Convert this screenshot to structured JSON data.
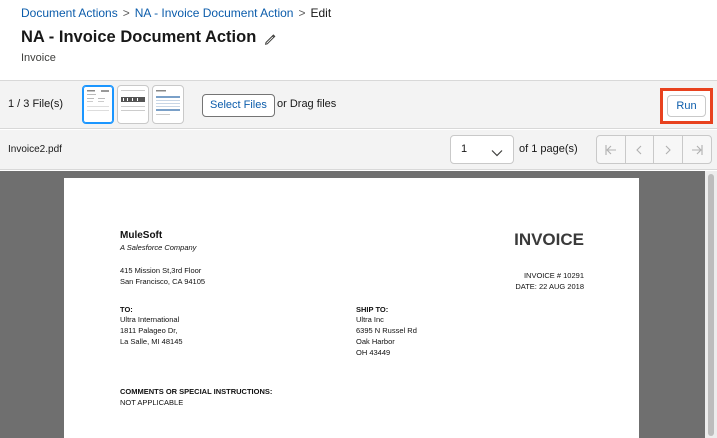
{
  "breadcrumb": {
    "items": [
      "Document Actions",
      "NA - Invoice Document Action"
    ],
    "current": "Edit",
    "separator": ">"
  },
  "header": {
    "title": "NA - Invoice Document Action",
    "subtitle": "Invoice"
  },
  "files_bar": {
    "file_count": "1 / 3 File(s)",
    "select_files_label": "Select Files",
    "drag_text": "or Drag files",
    "run_label": "Run"
  },
  "viewer_toolbar": {
    "file_name": "Invoice2.pdf",
    "page_select_value": "1",
    "page_of_text": "of 1 page(s)"
  },
  "document": {
    "company": "MuleSoft",
    "tagline": "A Salesforce Company",
    "address_line1": "415 Mission St,3rd Floor",
    "address_line2": "San Francisco, CA 94105",
    "invoice_title": "INVOICE",
    "invoice_number": "INVOICE # 10291",
    "invoice_date": "DATE: 22 AUG 2018",
    "to_label": "TO:",
    "to_lines": [
      "Ultra International",
      "1811 Palageo Dr,",
      "La Salle, MI 48145"
    ],
    "ship_to_label": "SHIP TO:",
    "ship_to_lines": [
      "Ultra Inc",
      "6395 N Russel Rd",
      "Oak Harbor",
      "OH 43449"
    ],
    "comments_label": "COMMENTS OR SPECIAL INSTRUCTIONS:",
    "comments_value": "NOT APPLICABLE"
  },
  "colors": {
    "link": "#0b5cab",
    "highlight": "#e8421f",
    "selected_thumb": "#1b96ff",
    "viewer_bg": "#6f6f6f"
  },
  "icons": {
    "edit": "pencil-icon",
    "page_select": "chevron-down-icon",
    "pager": [
      "first-page-icon",
      "previous-page-icon",
      "next-page-icon",
      "last-page-icon"
    ]
  }
}
